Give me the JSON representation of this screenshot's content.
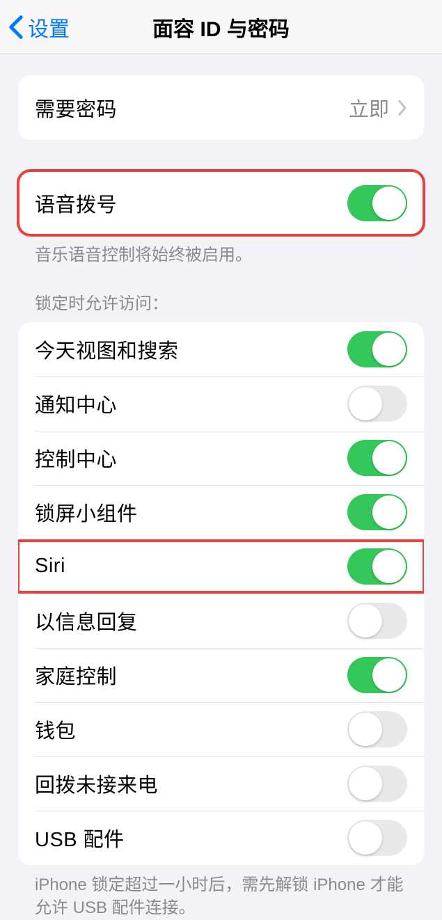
{
  "nav": {
    "back_label": "设置",
    "title": "面容 ID 与密码"
  },
  "require_passcode": {
    "label": "需要密码",
    "value": "立即"
  },
  "voice_dial": {
    "label": "语音拨号",
    "on": true,
    "footer": "音乐语音控制将始终被启用。"
  },
  "lock_access": {
    "header": "锁定时允许访问：",
    "items": [
      {
        "label": "今天视图和搜索",
        "on": true
      },
      {
        "label": "通知中心",
        "on": false
      },
      {
        "label": "控制中心",
        "on": true
      },
      {
        "label": "锁屏小组件",
        "on": true
      },
      {
        "label": "Siri",
        "on": true,
        "highlighted": true
      },
      {
        "label": "以信息回复",
        "on": false
      },
      {
        "label": "家庭控制",
        "on": true
      },
      {
        "label": "钱包",
        "on": false
      },
      {
        "label": "回拨未接来电",
        "on": false
      },
      {
        "label": "USB 配件",
        "on": false
      }
    ],
    "footer": "iPhone 锁定超过一小时后，需先解锁 iPhone 才能允许 USB 配件连接。"
  }
}
